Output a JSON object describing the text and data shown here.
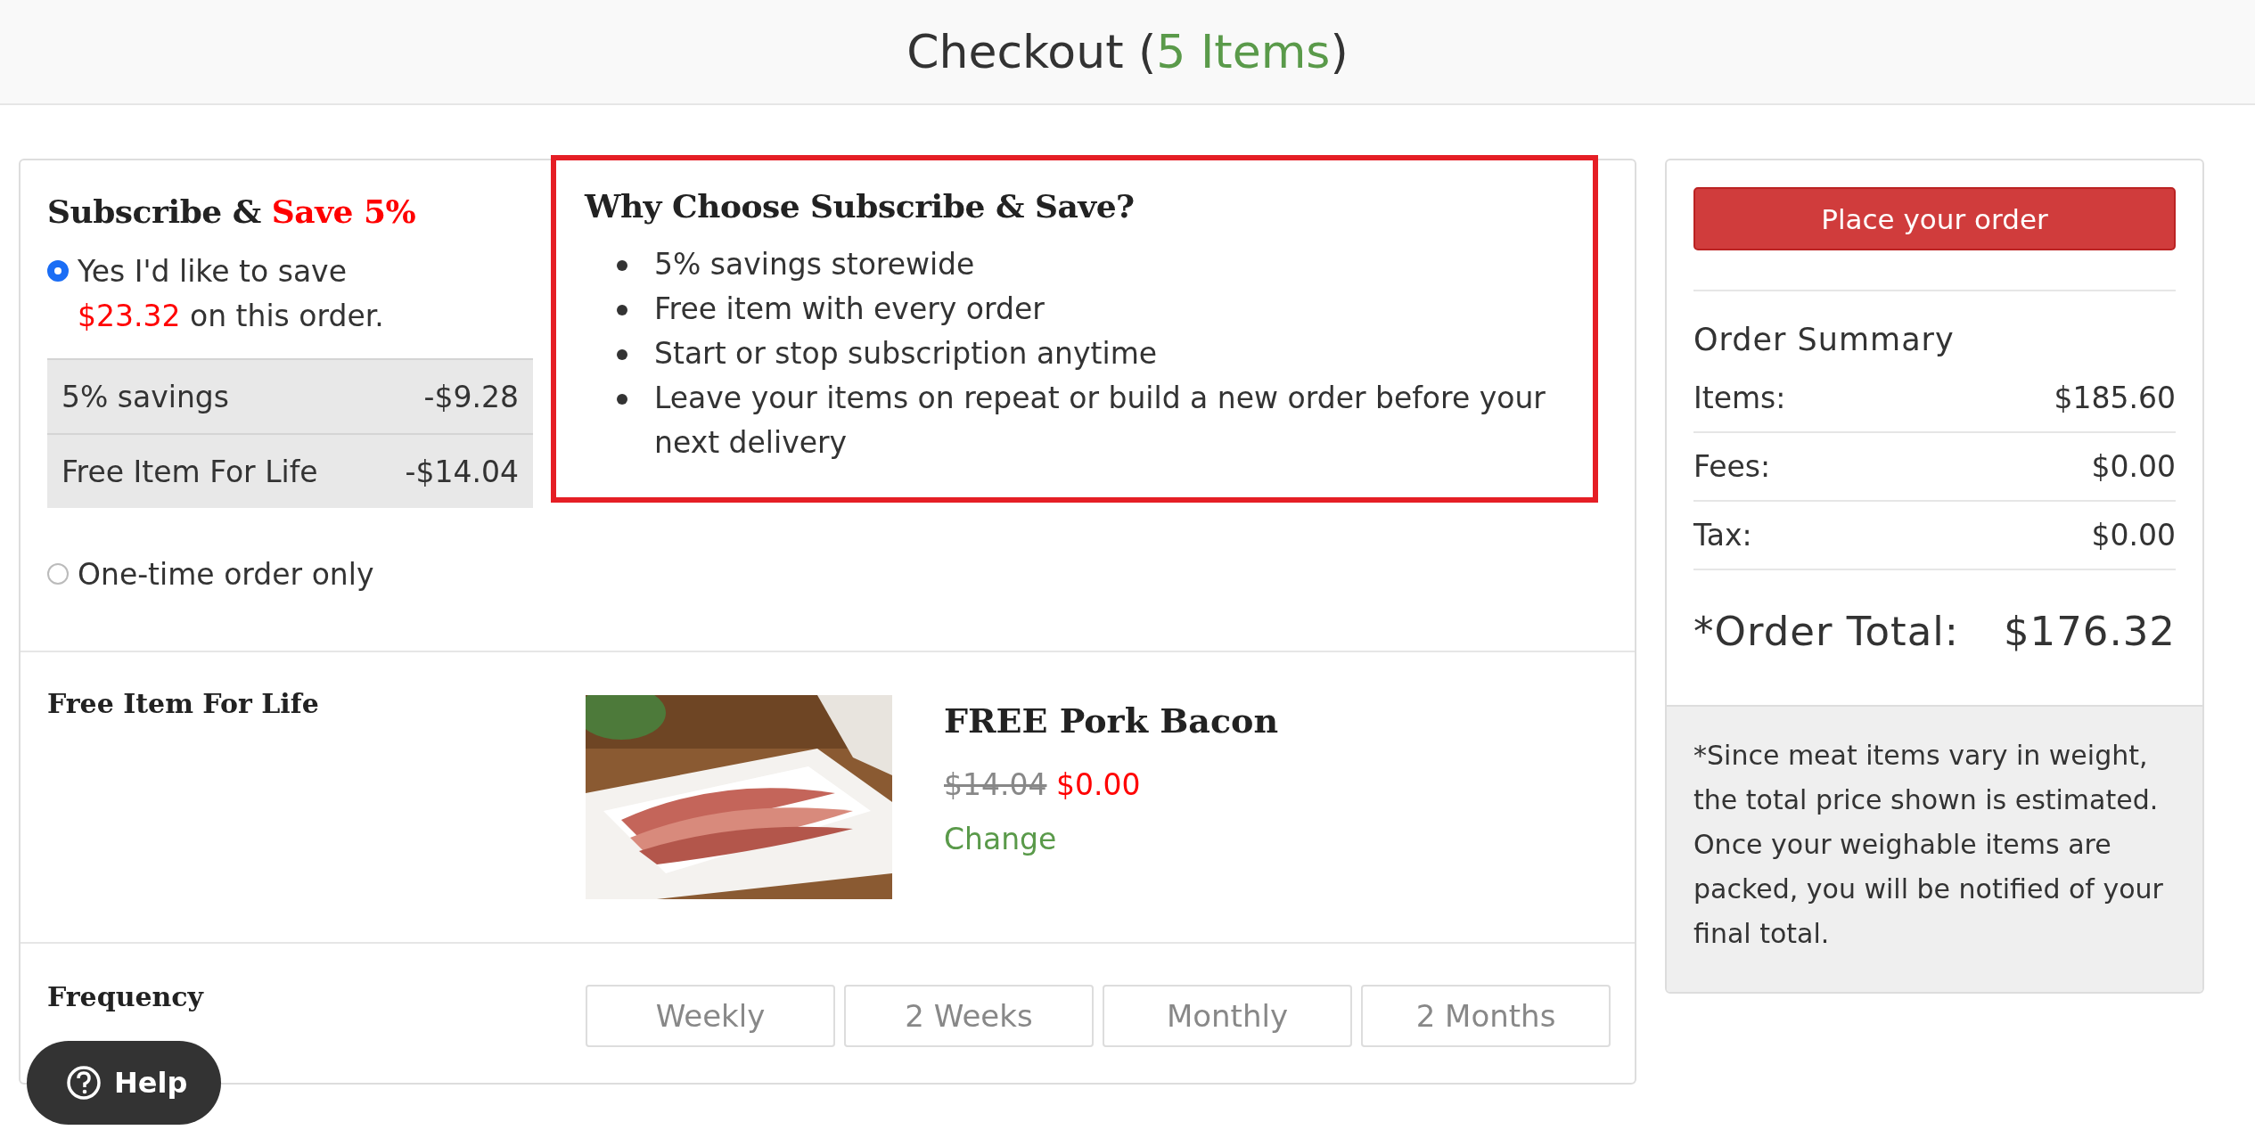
{
  "header": {
    "title": "Checkout (",
    "count": "5 Items",
    "close": ")"
  },
  "subscribe": {
    "heading": "Subscribe &",
    "heading_highlight": "Save 5%",
    "options": [
      {
        "kind": "subscribe",
        "label": "Yes I'd like to save",
        "amount": "$23.32",
        "label_after": "on this order.",
        "selected": true
      },
      {
        "kind": "plain",
        "label": "One-time order only",
        "selected": false
      }
    ],
    "savings": [
      {
        "label": "5% savings",
        "value": "-$9.28"
      },
      {
        "label": "Free Item For Life",
        "value": "-$14.04"
      }
    ]
  },
  "why": {
    "heading": "Why Choose Subscribe & Save?",
    "points": [
      "5% savings storewide",
      "Free item with every order",
      "Start or stop subscription anytime",
      "Leave your items on repeat or build a new order before your next delivery"
    ]
  },
  "free_item": {
    "label": "Free Item For Life",
    "name": "FREE Pork Bacon",
    "old_price": "$14.04",
    "price": "$0.00",
    "change": "Change"
  },
  "frequency": {
    "label": "Frequency",
    "options": [
      {
        "label": "Weekly",
        "selected": false
      },
      {
        "label": "2 Weeks",
        "selected": false
      },
      {
        "label": "Monthly",
        "selected": false
      },
      {
        "label": "2 Months",
        "selected": false
      }
    ]
  },
  "help": {
    "label": "Help"
  },
  "summary": {
    "button": "Place your order",
    "heading": "Order Summary",
    "rows": [
      {
        "label": "Items:",
        "value": "$185.60"
      },
      {
        "label": "Fees:",
        "value": "$0.00"
      },
      {
        "label": "Tax:",
        "value": "$0.00"
      }
    ],
    "total_label": "*Order Total:",
    "total_value": "$176.32",
    "note": "*Since meat items vary in weight, the total price shown is estimated. Once your weighable items are packed, you will be notified of your final total."
  }
}
